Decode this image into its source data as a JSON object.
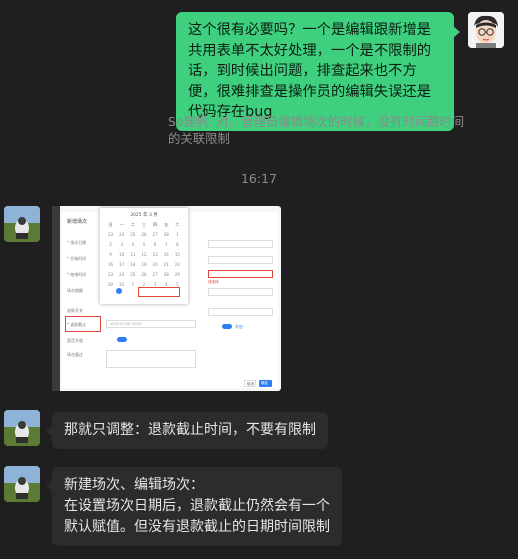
{
  "messages": {
    "me_1": "这个很有必要吗？一个是编辑跟新增是共用表单不太好处理，一个是不限制的话，到时候出问题，排查起来也不方便，很难排查是操作员的编辑失误还是代码存在bug",
    "quote_1": "So建帆: 对。管理员编辑场次的时候，没有时间跟时间的关联限制",
    "timestamp": "16:17",
    "other_2": "那就只调整：退款截止时间，不要有限制",
    "other_3_line1": "新建场次、编辑场次：",
    "other_3_line2": "在设置场次日期后，退款截止仍然会有一个默认赋值。但没有退款截止的日期时间限制"
  },
  "screenshot": {
    "dialog_title": "新增场次",
    "calendar_header": "2025 年 3 月",
    "weekdays": [
      "日",
      "一",
      "二",
      "三",
      "四",
      "五",
      "六"
    ],
    "days": [
      "23",
      "24",
      "25",
      "26",
      "27",
      "28",
      "1",
      "2",
      "3",
      "4",
      "5",
      "6",
      "7",
      "8",
      "9",
      "10",
      "11",
      "12",
      "13",
      "14",
      "15",
      "16",
      "17",
      "18",
      "19",
      "20",
      "21",
      "22",
      "23",
      "24",
      "25",
      "26",
      "27",
      "28",
      "29",
      "30",
      "31",
      "1",
      "2",
      "3",
      "4",
      "5"
    ],
    "refund_value": "2025-03-26 23:59",
    "toggle_label": "开启",
    "confirm_label": "确定",
    "cancel_label": "取消"
  },
  "icons": {
    "me_avatar": "cartoon-face-avatar",
    "other_avatar": "landscape-photo-avatar"
  }
}
